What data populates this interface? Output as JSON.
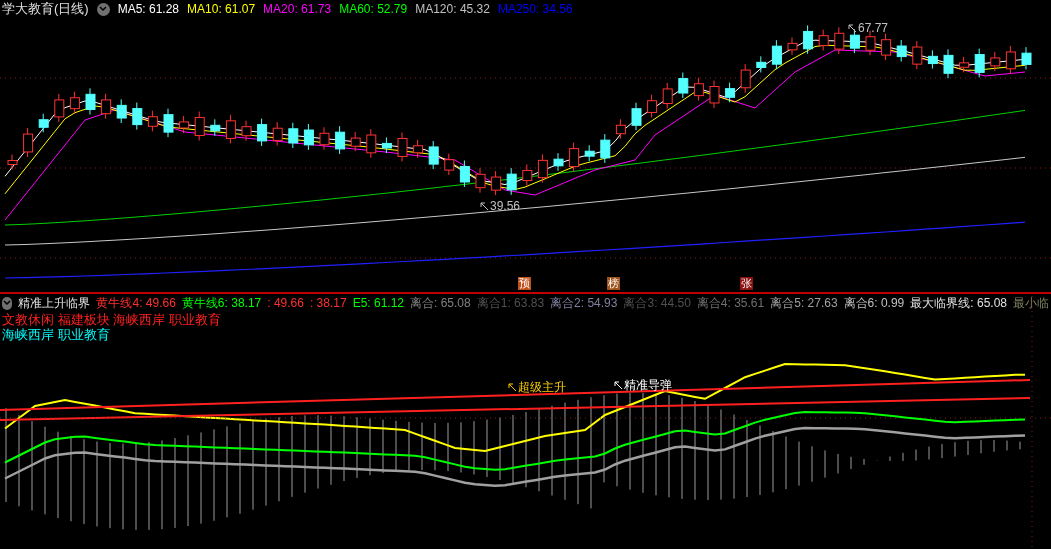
{
  "header": {
    "title": "学大教育(日线)",
    "ma_legend": [
      {
        "label": "MA5: 61.28",
        "color": "#ffffff"
      },
      {
        "label": "MA10: 61.07",
        "color": "#ffff00"
      },
      {
        "label": "MA20: 61.73",
        "color": "#ff00ff"
      },
      {
        "label": "MA60: 52.79",
        "color": "#00ff00"
      },
      {
        "label": "MA120: 45.32",
        "color": "#c0c0c0"
      },
      {
        "label": "MA250: 34.56",
        "color": "#0000ff"
      }
    ]
  },
  "main_chart": {
    "high_label": "67.77",
    "low_label": "39.56",
    "markers": [
      {
        "label": "预",
        "color": "#c0501a"
      },
      {
        "label": "榜",
        "color": "#a0521a"
      },
      {
        "label": "张",
        "color": "#8b1010"
      }
    ]
  },
  "indicator": {
    "name": "精准上升临界",
    "legend": [
      {
        "label": "黄牛线4: 49.66",
        "color": "#ff3030"
      },
      {
        "label": "黄牛线6: 38.17",
        "color": "#00ff00"
      },
      {
        "label": ": 49.66",
        "color": "#ff3030"
      },
      {
        "label": ": 38.17",
        "color": "#ff3030"
      },
      {
        "label": "E5: 61.12",
        "color": "#00ff00"
      },
      {
        "label": "离合: 65.08",
        "color": "#808080"
      },
      {
        "label": "离合1: 63.83",
        "color": "#505050"
      },
      {
        "label": "离合2: 54.93",
        "color": "#8080a0"
      },
      {
        "label": "离合3: 44.50",
        "color": "#505050"
      },
      {
        "label": "离合4: 35.61",
        "color": "#707070"
      },
      {
        "label": "离合5: 27.63",
        "color": "#a0a0a0"
      },
      {
        "label": "离合6: 0.99",
        "color": "#c0c0c0"
      },
      {
        "label": "最大临界线: 65.08",
        "color": "#e0e0e0"
      },
      {
        "label": "最小临",
        "color": "#808060"
      }
    ],
    "tags": [
      {
        "label": "文教休闲 福建板块 海峡西岸 职业教育",
        "color": "#ff2020"
      },
      {
        "label": "海峡西岸 职业教育",
        "color": "#00ffff"
      }
    ],
    "signals": [
      "超级主升",
      "精准导弹"
    ]
  }
}
